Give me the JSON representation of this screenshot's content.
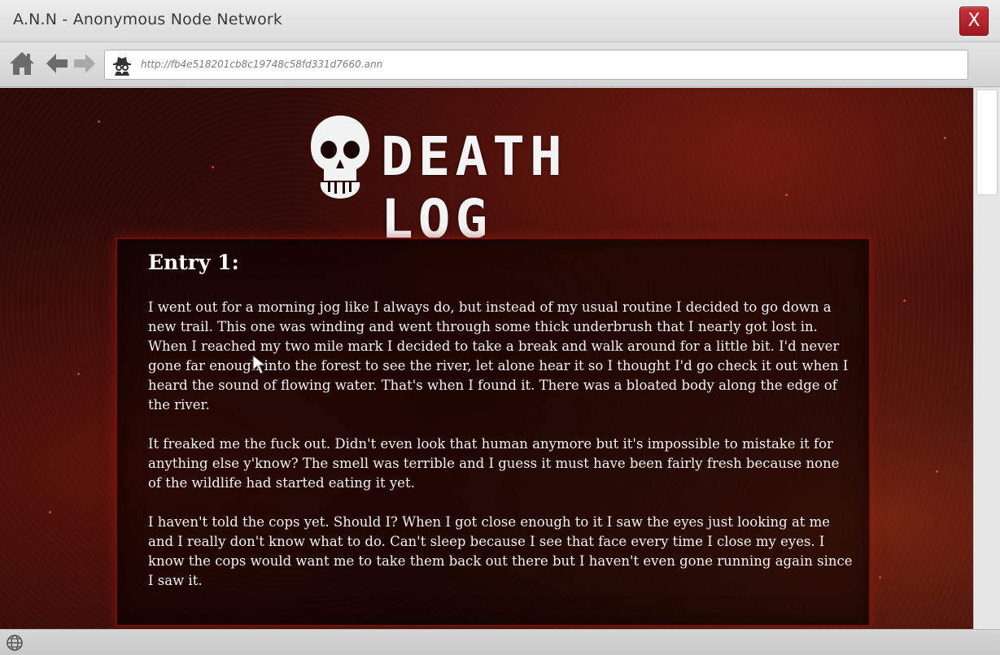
{
  "window": {
    "title": "A.N.N - Anonymous Node Network",
    "close_label": "X"
  },
  "toolbar": {
    "home_icon": "home-icon",
    "back_icon": "arrow-left-icon",
    "forward_icon": "arrow-right-icon",
    "address_icon": "spy-icon",
    "url": "http://fb4e518201cb8c19748c58fd331d7660.ann"
  },
  "page": {
    "logo_text": "DEATH LOG",
    "entry": {
      "title": "Entry 1:",
      "paragraphs": [
        "I went out for a morning jog like I always do, but instead of my usual routine I decided to go down a new trail. This one was winding and went through some thick underbrush that I nearly got lost in. When I reached my two mile mark I decided to take a break and walk around for a little bit. I'd never gone far enough into the forest to see the river, let alone hear it so I thought I'd go check it out when I heard the sound of flowing water. That's when I found it. There was a bloated body along the edge of the river.",
        "It freaked me the fuck out. Didn't even look that human anymore but it's impossible to mistake it for anything else y'know? The smell was terrible and I guess it must have been fairly fresh because none of the wildlife had started eating it yet.",
        "I haven't told the cops yet. Should I? When I got close enough to it I saw the eyes just looking at me and I really don't know what to do. Can't sleep because I see that face every time I close my eyes. I know the cops would want me to take them back out there but I haven't even gone running again since I saw it."
      ]
    }
  },
  "colors": {
    "close_button": "#b3242c",
    "panel_border": "#8c140f",
    "background": "#2a0a07"
  }
}
